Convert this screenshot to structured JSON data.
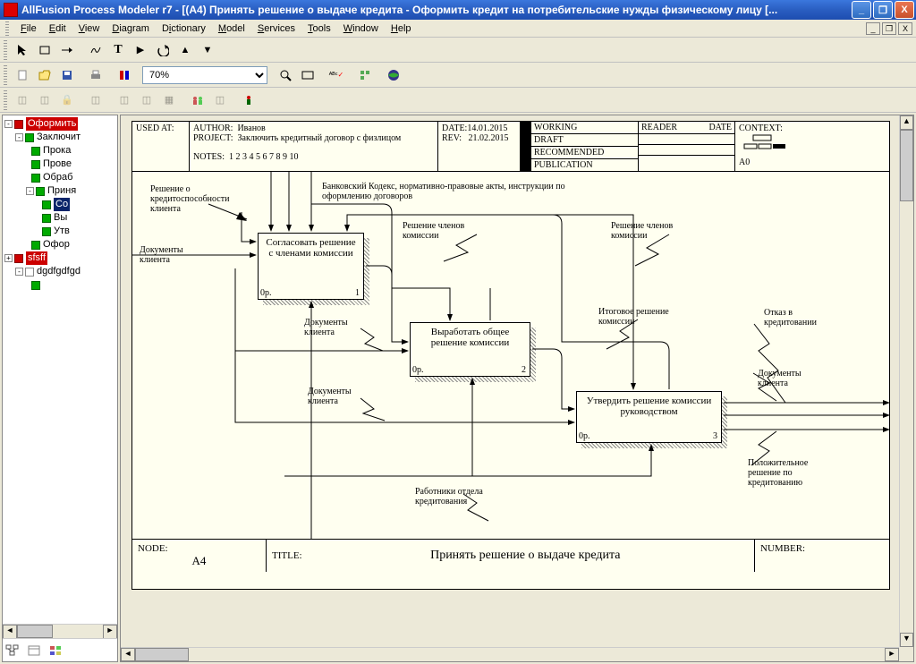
{
  "window": {
    "title": "AllFusion Process Modeler r7 - [(А4) Принять решение о  выдаче кредита - Оформить кредит на потребительские нужды физическому лицу  [..."
  },
  "menu": [
    "File",
    "Edit",
    "View",
    "Diagram",
    "Dictionary",
    "Model",
    "Services",
    "Tools",
    "Window",
    "Help"
  ],
  "zoom": "70%",
  "tree": {
    "root": "Оформить",
    "n1": "Заключит",
    "n1_1": "Прока",
    "n1_2": "Прове",
    "n1_3": "Обраб",
    "n1_4": "Приня",
    "n1_4_1": "Со",
    "n1_4_2": "Вы",
    "n1_4_3": "Утв",
    "n1_5": "Офор",
    "root2": "sfsff",
    "n2": "dgdfgdfgd"
  },
  "header": {
    "used_at_lbl": "USED AT:",
    "author_lbl": "AUTHOR:",
    "author": "Иванов",
    "project_lbl": "PROJECT:",
    "project": "Заключить кредитный договор с физлицом",
    "notes_lbl": "NOTES:",
    "notes": "1  2  3  4  5  6  7  8  9  10",
    "date_lbl": "DATE:",
    "date": "14.01.2015",
    "rev_lbl": "REV:",
    "rev": "21.02.2015",
    "working": "WORKING",
    "draft": "DRAFT",
    "recommended": "RECOMMENDED",
    "publication": "PUBLICATION",
    "reader_lbl": "READER",
    "date2_lbl": "DATE",
    "context_lbl": "CONTEXT:",
    "context_code": "А0"
  },
  "boxes": {
    "b1": {
      "text": "Согласовать решение с членами комиссии",
      "cost": "0р.",
      "num": "1"
    },
    "b2": {
      "text": "Выработать общее решение комиссии",
      "cost": "0р.",
      "num": "2"
    },
    "b3": {
      "text": "Утвердить решение комиссии руководством",
      "cost": "0р.",
      "num": "3"
    }
  },
  "labels": {
    "l_reshenie": "Решение о кредитоспособности клиента",
    "l_docs": "Документы клиента",
    "l_bank": "Банковский Кодекс, нормативно-правовые акты, инструкции по оформлению договоров",
    "l_chlenov1": "Решение членов комиссии",
    "l_chlenov2": "Решение членов комиссии",
    "l_docs2": "Документы клиента",
    "l_docs3": "Документы клиента",
    "l_itog": "Итоговое решение комиссии",
    "l_otkaz": "Отказ в кредитовании",
    "l_docs4": "Документы клиента",
    "l_pozh": "Положительное решение по кредитованию",
    "l_rab": "Работники отдела кредитования"
  },
  "footer": {
    "node_lbl": "NODE:",
    "node": "А4",
    "title_lbl": "TITLE:",
    "title": "Принять решение о  выдаче кредита",
    "number_lbl": "NUMBER:"
  }
}
